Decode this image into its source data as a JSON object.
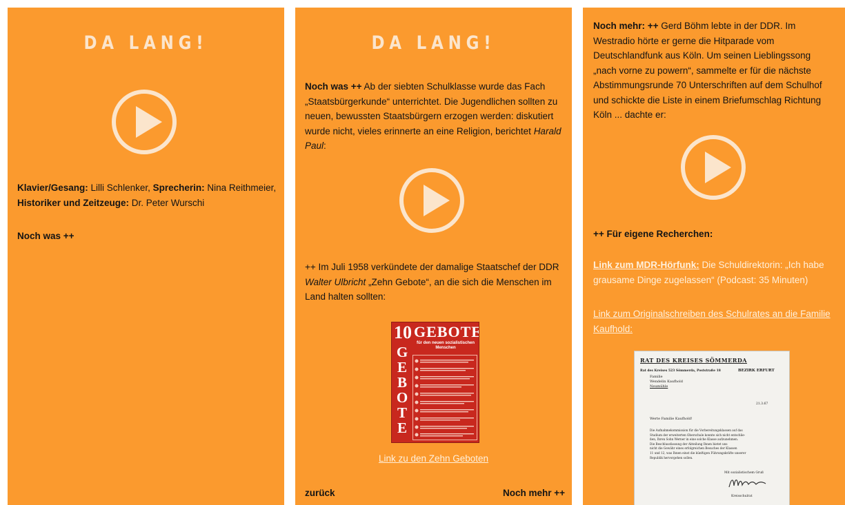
{
  "panel1": {
    "title": "DA LANG!",
    "play_icon": "play-icon",
    "credits": {
      "label1": "Klavier/Gesang:",
      "value1": " Lilli Schlenker, ",
      "label2": "Sprecherin:",
      "value2": " Nina Reithmeier, ",
      "label3": "Historiker und Zeitzeuge:",
      "value3": " Dr. Peter Wurschi"
    },
    "more_link": "Noch was ++"
  },
  "panel2": {
    "title": "DA LANG!",
    "intro_bold": "Noch was ++",
    "intro_text": " Ab der siebten Schulklasse wurde das Fach „Staatsbürgerkunde“ unterrichtet. Die Jugendlichen sollten zu neuen, bewussten Staatsbürgern erzogen werden: diskutiert wurde nicht, vieles erinnerte an eine Religion, berichtet ",
    "intro_name": "Harald Paul",
    "intro_end": ":",
    "play_icon": "play-icon",
    "second_a": "++ Im Juli 1958 verkündete der damalige Staatschef der DDR ",
    "second_name": "Walter Ulbricht",
    "second_b": " „Zehn Gebote“, an die sich die Menschen im Land halten sollten:",
    "poster": {
      "number": "10",
      "heading": "GEBOTE",
      "subheading": "für den neuen sozialistischen Menschen",
      "side_letters": [
        "G",
        "E",
        "B",
        "O",
        "T",
        "E"
      ]
    },
    "poster_link": "Link zu den Zehn Geboten",
    "back": "zurück",
    "next": "Noch mehr ++"
  },
  "panel3": {
    "intro_bold": "Noch mehr: ++",
    "intro_text": " Gerd Böhm lebte in der DDR. Im Westradio hörte er gerne die Hitparade vom Deutschlandfunk aus Köln. Um seinen Lieblingssong „nach vorne zu powern“, sammelte er für die nächste Abstimmungsrunde 70 Unterschriften auf dem Schulhof und schickte die Liste in einem Briefumschlag Richtung Köln ... dachte er:",
    "play_icon": "play-icon",
    "research_heading": "++ Für eigene Recherchen:",
    "link1_label": "Link zum MDR-Hörfunk:",
    "link1_text": " Die Schuldirektorin: „Ich habe grausame Dinge zugelassen“ (Podcast: 35 Minuten)",
    "link2": "Link zum Originalschreiben des Schulrates an die Familie Kaufhold:",
    "letter": {
      "header": "RAT DES KREISES SÖMMERDA",
      "sender_line": "Rat des Kreises 523 Sömmerda, Poststraße 18",
      "district": "BEZIRK ERFURT",
      "recipient": [
        "Familie",
        "Wendelin Kaufhold",
        "Neumühle"
      ],
      "date": "21.3.67",
      "salutation": "Werte Familie Kaufhold!",
      "body": [
        "Die Aufnahmekommission für die Vorbereitungsklassen auf das",
        "Studium der erweiterten Oberschule konnte sich nicht entschlie-",
        "ßen, Ihren Sohn Werner in eine solche Klasse aufzunehmen.",
        "Die Beschlussfassung der Abteilung Ihnen bietet uns",
        "nicht die Gewähr eines erfolgreichen Besuches der Klassen",
        "11 und 12, was Ihnen einst die künftigen Führungskräfte unserer",
        "Republik hervorgehen sollen."
      ],
      "closing": "Mit sozialistischem Gruß",
      "signer": "Kreisschulrat"
    }
  }
}
